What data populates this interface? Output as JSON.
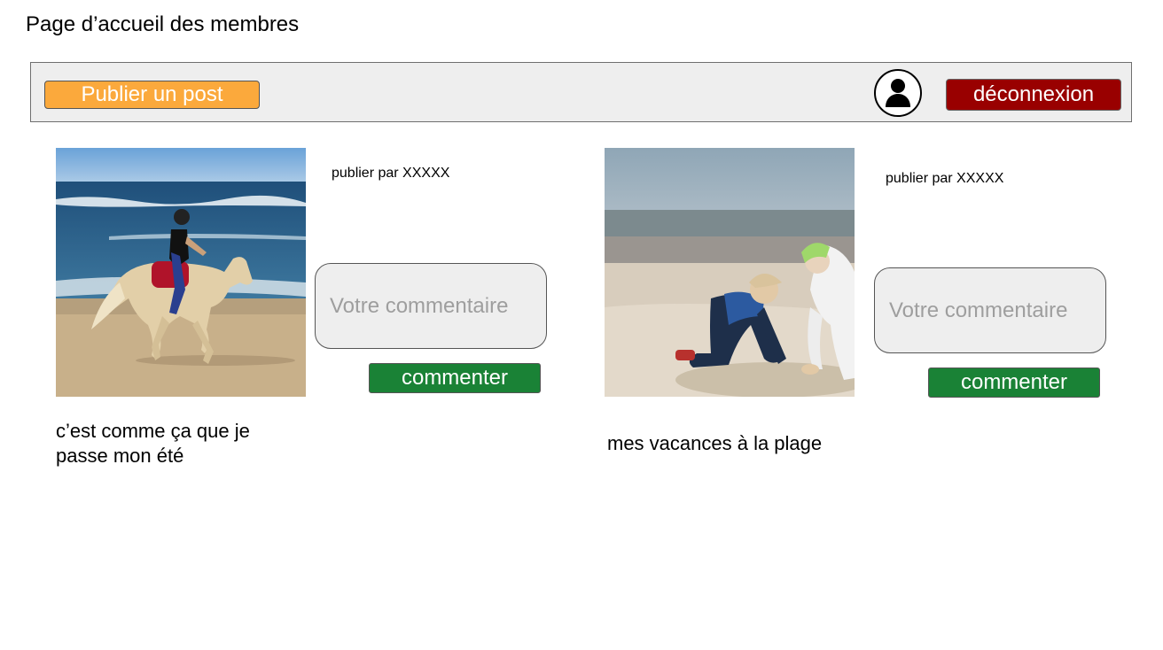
{
  "page": {
    "title": "Page d’accueil des membres"
  },
  "header": {
    "publish_label": "Publier un post",
    "avatar_icon": "user-icon",
    "logout_label": "déconnexion"
  },
  "posts": [
    {
      "image": "horse-rider-beach-photo",
      "author_text": "publier par XXXXX",
      "comment_placeholder": "Votre commentaire",
      "comment_button": "commenter",
      "caption": "c’est comme ça que je\npasse mon été"
    },
    {
      "image": "children-digging-sand-photo",
      "author_text": "publier par XXXXX",
      "comment_placeholder": "Votre commentaire",
      "comment_button": "commenter",
      "caption": "mes vacances à la plage"
    }
  ],
  "colors": {
    "publish": "#fba93c",
    "logout": "#990000",
    "comment": "#1a8236",
    "header_bg": "#eeeeee"
  }
}
